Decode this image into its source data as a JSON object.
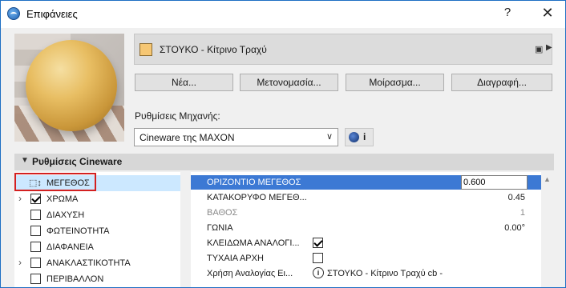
{
  "window": {
    "title": "Επιφάνειες",
    "help_label": "?",
    "close_label": "✕"
  },
  "surface": {
    "name": "ΣΤΟΥΚΟ - Κίτρινο Τραχύ",
    "swatch_color": "#f6c774",
    "browse_icon": "▣",
    "browse_arrow": "▶"
  },
  "buttons": {
    "new": "Νέα...",
    "rename": "Μετονομασία...",
    "share": "Μοίρασμα...",
    "delete": "Διαγραφή..."
  },
  "engine": {
    "label": "Ρυθμίσεις Μηχανής:",
    "selected": "Cineware της MAXON",
    "chevron": "∨",
    "info_label": "i"
  },
  "section": {
    "arrow": "▼",
    "label": "Ρυθμίσεις Cineware"
  },
  "channels": [
    {
      "label": "ΜΕΓΕΘΟΣ",
      "checked": null,
      "expandable": false,
      "selected": true,
      "icon": "size-icon"
    },
    {
      "label": "ΧΡΩΜΑ",
      "checked": true,
      "expandable": true,
      "selected": false
    },
    {
      "label": "ΔΙΑΧΥΣΗ",
      "checked": false,
      "expandable": false,
      "selected": false
    },
    {
      "label": "ΦΩΤΕΙΝΟΤΗΤΑ",
      "checked": false,
      "expandable": false,
      "selected": false
    },
    {
      "label": "ΔΙΑΦΑΝΕΙΑ",
      "checked": false,
      "expandable": false,
      "selected": false
    },
    {
      "label": "ΑΝΑΚΛΑΣΤΙΚΟΤΗΤΑ",
      "checked": false,
      "expandable": true,
      "selected": false
    },
    {
      "label": "ΠΕΡΙΒΑΛΛΟΝ",
      "checked": false,
      "expandable": false,
      "selected": false
    }
  ],
  "properties": [
    {
      "label": "ΟΡΙΖΟΝΤΙΟ ΜΕΓΕΘΟΣ",
      "value": "0.600",
      "selected": true,
      "dim": false,
      "kind": "edit"
    },
    {
      "label": "ΚΑΤΑΚΟΡΥΦΟ ΜΕΓΕΘ...",
      "value": "0.45",
      "selected": false,
      "dim": false,
      "kind": "text"
    },
    {
      "label": "ΒΑΘΟΣ",
      "value": "1",
      "selected": false,
      "dim": true,
      "kind": "text"
    },
    {
      "label": "ΓΩΝΙΑ",
      "value": "0.00°",
      "selected": false,
      "dim": false,
      "kind": "text"
    },
    {
      "label": "ΚΛΕΙΔΩΜΑ ΑΝΑΛΟΓΙ...",
      "value": "",
      "selected": false,
      "dim": false,
      "kind": "checkbox",
      "checked": true
    },
    {
      "label": "ΤΥΧΑΙΑ ΑΡΧΗ",
      "value": "",
      "selected": false,
      "dim": false,
      "kind": "checkbox",
      "checked": false
    },
    {
      "label": "Χρήση Αναλογίας Ει...",
      "value": "ΣΤΟΥΚΟ - Κίτρινο Τραχύ cb -",
      "selected": false,
      "dim": false,
      "kind": "ref",
      "ref_icon": "i"
    }
  ],
  "scroll_up": "▲"
}
